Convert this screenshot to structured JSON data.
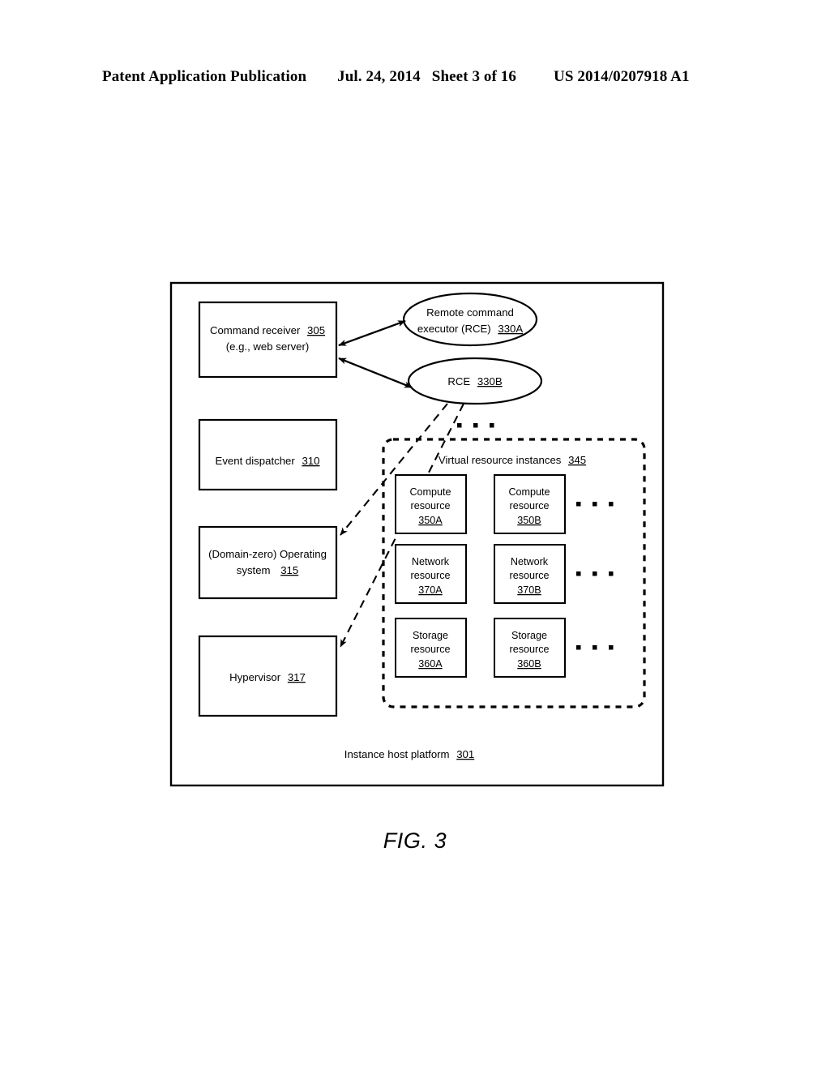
{
  "header": {
    "publication": "Patent Application Publication",
    "date": "Jul. 24, 2014",
    "sheet": "Sheet 3 of 16",
    "number": "US 2014/0207918 A1"
  },
  "figure": {
    "caption": "FIG. 3",
    "platform_label": "Instance host platform",
    "platform_ref": "301",
    "command_receiver": {
      "line1_label": "Command receiver",
      "line1_ref": "305",
      "line2": "(e.g., web server)"
    },
    "rce_a": {
      "line1": "Remote command",
      "line2_label": "executor (RCE)",
      "line2_ref": "330A"
    },
    "rce_b": {
      "label": "RCE",
      "ref": "330B"
    },
    "event_dispatcher": {
      "label": "Event dispatcher",
      "ref": "310"
    },
    "operating_system": {
      "line1": "(Domain-zero) Operating",
      "line2_label": "system",
      "line2_ref": "315"
    },
    "hypervisor": {
      "label": "Hypervisor",
      "ref": "317"
    },
    "virtual_resources": {
      "title_label": "Virtual resource instances",
      "title_ref": "345",
      "ellipsis": "...",
      "rows": [
        {
          "type": "compute",
          "items": [
            {
              "line1": "Compute",
              "line2": "resource",
              "ref": "350A"
            },
            {
              "line1": "Compute",
              "line2": "resource",
              "ref": "350B"
            }
          ]
        },
        {
          "type": "network",
          "items": [
            {
              "line1": "Network",
              "line2": "resource",
              "ref": "370A"
            },
            {
              "line1": "Network",
              "line2": "resource",
              "ref": "370B"
            }
          ]
        },
        {
          "type": "storage",
          "items": [
            {
              "line1": "Storage",
              "line2": "resource",
              "ref": "360A"
            },
            {
              "line1": "Storage",
              "line2": "resource",
              "ref": "360B"
            }
          ]
        }
      ]
    }
  }
}
